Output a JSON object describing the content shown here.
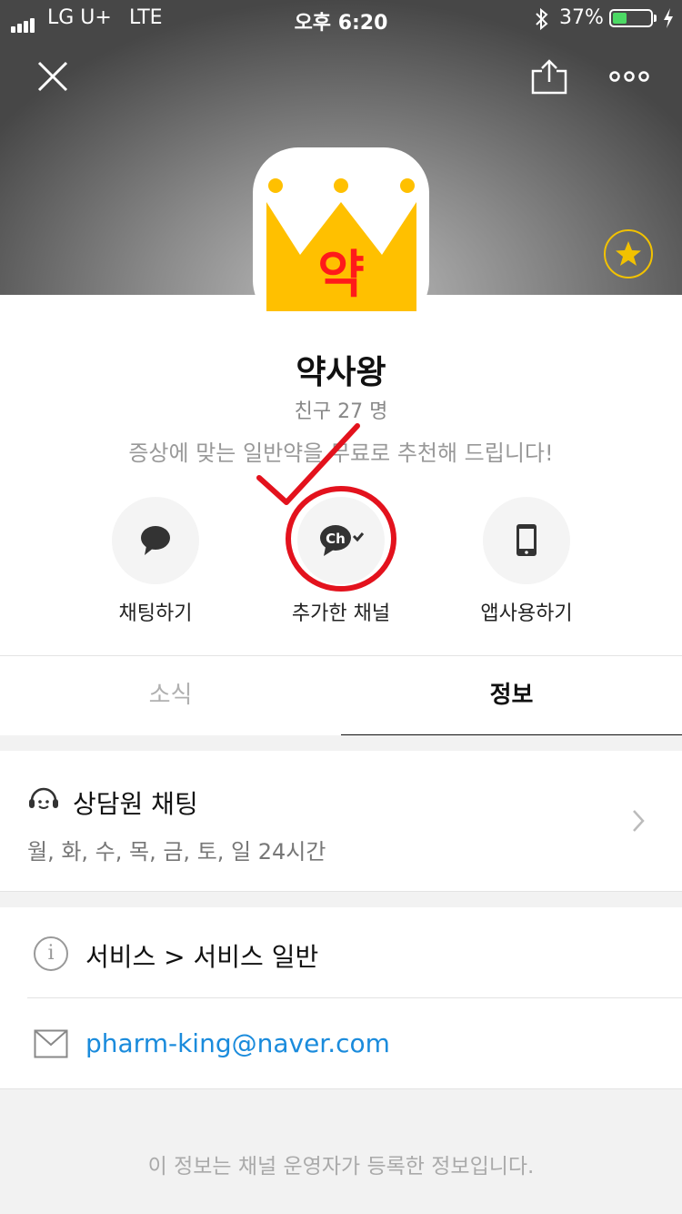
{
  "status_bar": {
    "carrier": "LG U+",
    "network": "LTE",
    "time": "오후 6:20",
    "battery_percent": "37%",
    "battery_level": 0.37,
    "icons": [
      "signal-icon",
      "bluetooth-icon",
      "battery-icon",
      "charging-icon"
    ]
  },
  "header": {
    "close_icon": "close-icon",
    "share_icon": "share-icon",
    "more_icon": "more-icon",
    "favorite_icon": "star-icon"
  },
  "profile": {
    "logo_text": "약",
    "name": "약사왕",
    "friends": "친구 27 명",
    "description": "증상에 맞는 일반약을 무료로 추천해 드립니다!"
  },
  "actions": [
    {
      "label": "채팅하기",
      "icon": "chat-bubble-icon"
    },
    {
      "label": "추가한 채널",
      "icon": "channel-added-icon",
      "icon_text": "Ch"
    },
    {
      "label": "앱사용하기",
      "icon": "phone-icon"
    }
  ],
  "tabs": [
    {
      "label": "소식",
      "active": false
    },
    {
      "label": "정보",
      "active": true
    }
  ],
  "info": {
    "counsel_title": "상담원 채팅",
    "counsel_hours": "월, 화, 수, 목, 금, 토, 일  24시간",
    "category": "서비스 > 서비스 일반",
    "email": "pharm-king@naver.com",
    "footer_note": "이 정보는 채널 운영자가 등록한 정보입니다."
  },
  "colors": {
    "accent_yellow": "#ffc000",
    "link_blue": "#1a8bdc",
    "annotation_red": "#e3121d",
    "battery_green": "#4cd964"
  }
}
